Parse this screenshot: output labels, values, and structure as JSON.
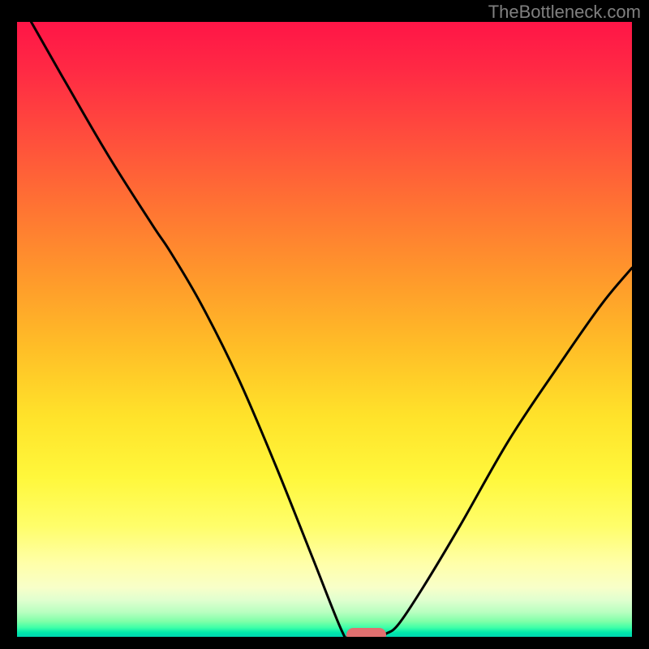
{
  "watermark": "TheBottleneck.com",
  "colors": {
    "frame": "#000000",
    "curve": "#000000",
    "marker": "#e17070",
    "watermark": "#808080"
  },
  "chart_data": {
    "type": "line",
    "title": "",
    "xlabel": "",
    "ylabel": "",
    "xlim": [
      0,
      100
    ],
    "ylim": [
      0,
      100
    ],
    "curve": [
      {
        "x": 2.3,
        "y": 100
      },
      {
        "x": 8,
        "y": 90
      },
      {
        "x": 15,
        "y": 78
      },
      {
        "x": 22,
        "y": 67
      },
      {
        "x": 25,
        "y": 62.5
      },
      {
        "x": 30,
        "y": 54
      },
      {
        "x": 36,
        "y": 42
      },
      {
        "x": 42,
        "y": 28
      },
      {
        "x": 48,
        "y": 13
      },
      {
        "x": 52.8,
        "y": 1
      },
      {
        "x": 54,
        "y": 0
      },
      {
        "x": 57,
        "y": 0
      },
      {
        "x": 59,
        "y": 0
      },
      {
        "x": 60,
        "y": 0.5
      },
      {
        "x": 62,
        "y": 2
      },
      {
        "x": 66,
        "y": 8
      },
      {
        "x": 72,
        "y": 18
      },
      {
        "x": 80,
        "y": 32
      },
      {
        "x": 88,
        "y": 44
      },
      {
        "x": 95,
        "y": 54
      },
      {
        "x": 100,
        "y": 60
      }
    ],
    "marker": {
      "x_start": 53.5,
      "x_end": 60,
      "y": 0
    },
    "gradient_stops": [
      {
        "pos": 0,
        "color": "#ff1547"
      },
      {
        "pos": 18,
        "color": "#ff4b3d"
      },
      {
        "pos": 42,
        "color": "#ff9a2b"
      },
      {
        "pos": 64,
        "color": "#ffe22a"
      },
      {
        "pos": 82,
        "color": "#fffe6a"
      },
      {
        "pos": 94,
        "color": "#e0ffcf"
      },
      {
        "pos": 100,
        "color": "#00d4b0"
      }
    ]
  }
}
